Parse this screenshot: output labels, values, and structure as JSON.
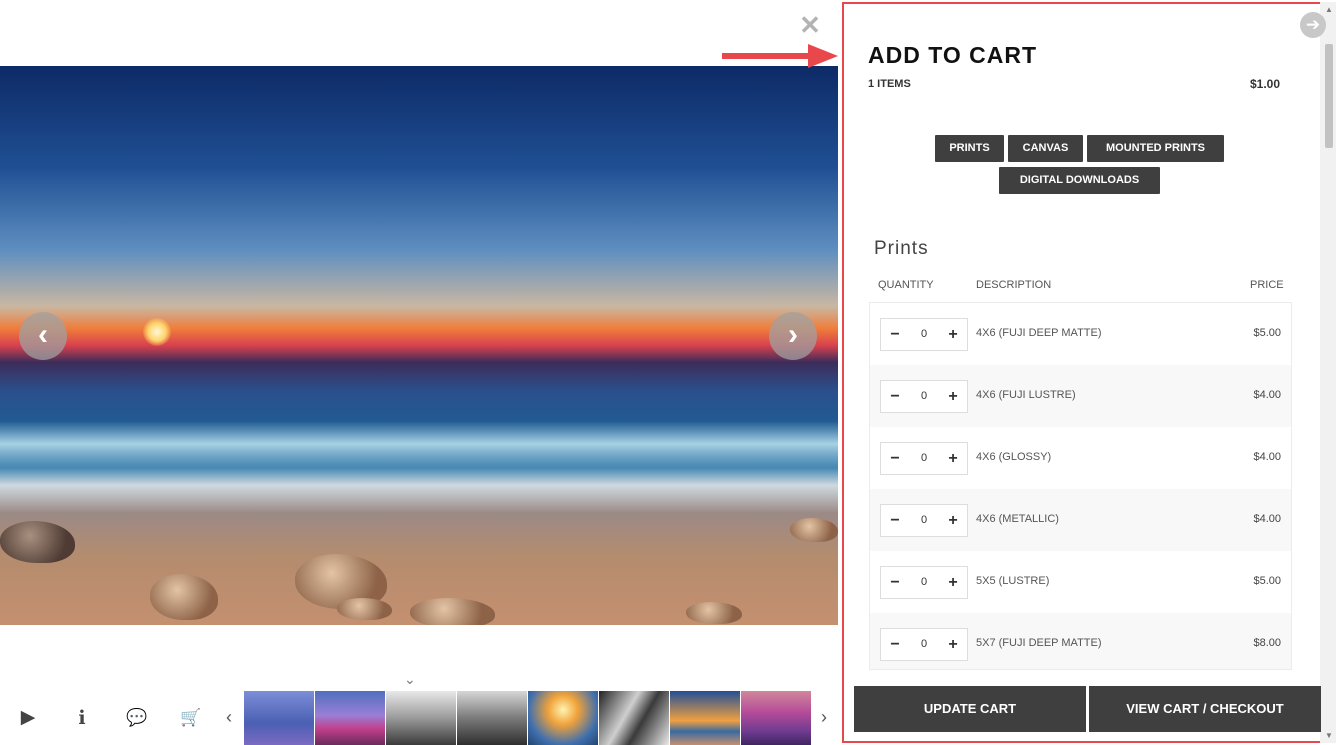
{
  "viewer": {
    "close_glyph": "✕",
    "prev_glyph": "‹",
    "next_glyph": "›",
    "toggle_glyph": "⌄",
    "toolbar": {
      "play_glyph": "▶",
      "info_glyph": "i",
      "comment_glyph": "💬",
      "cart_glyph": "🛒",
      "thumb_left_glyph": "‹",
      "thumb_right_glyph": "›"
    }
  },
  "cart": {
    "title": "ADD TO CART",
    "item_count": "1 ITEMS",
    "total": "$1.00",
    "collapse_glyph": "➔",
    "categories": [
      "PRINTS",
      "CANVAS",
      "MOUNTED PRINTS",
      "DIGITAL DOWNLOADS"
    ],
    "section_title": "Prints",
    "columns": {
      "quantity": "QUANTITY",
      "description": "DESCRIPTION",
      "price": "PRICE"
    },
    "rows": [
      {
        "qty": "0",
        "desc": "4X6 (FUJI DEEP MATTE)",
        "price": "$5.00"
      },
      {
        "qty": "0",
        "desc": "4X6 (FUJI LUSTRE)",
        "price": "$4.00"
      },
      {
        "qty": "0",
        "desc": "4X6 (GLOSSY)",
        "price": "$4.00"
      },
      {
        "qty": "0",
        "desc": "4X6 (METALLIC)",
        "price": "$4.00"
      },
      {
        "qty": "0",
        "desc": "5X5 (LUSTRE)",
        "price": "$5.00"
      },
      {
        "qty": "0",
        "desc": "5X7 (FUJI DEEP MATTE)",
        "price": "$8.00"
      }
    ],
    "minus_glyph": "−",
    "plus_glyph": "+",
    "update_label": "UPDATE CART",
    "checkout_label": "VIEW CART / CHECKOUT"
  },
  "colors": {
    "accent": "#e8484b",
    "button": "#3f3f3f"
  }
}
